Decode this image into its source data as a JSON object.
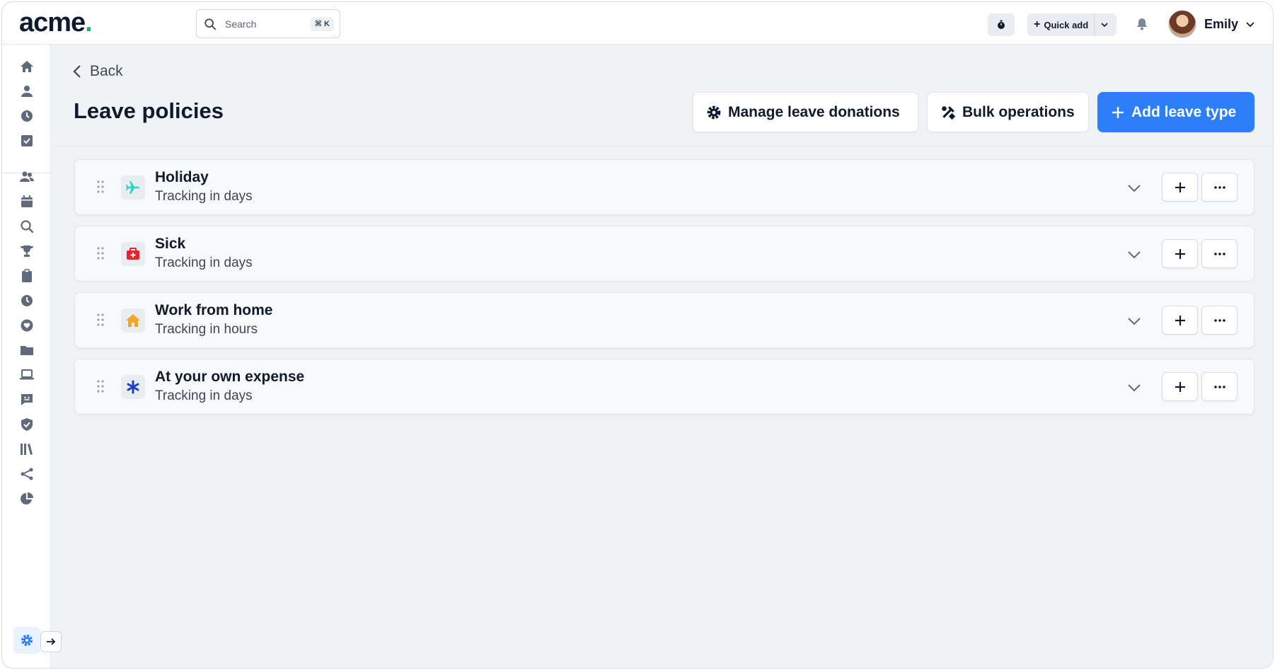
{
  "topbar": {
    "logo": "acme",
    "logo_dot": ".",
    "search_placeholder": "Search",
    "search_shortcut": "⌘ K",
    "quick_add_label": "Quick add",
    "user_name": "Emily"
  },
  "sidebar": {
    "items": [
      {
        "icon": "home-icon"
      },
      {
        "icon": "person-icon"
      },
      {
        "icon": "clock-icon"
      },
      {
        "icon": "checkbox-icon"
      },
      {
        "icon": "people-icon"
      },
      {
        "icon": "calendar-icon"
      },
      {
        "icon": "search-icon"
      },
      {
        "icon": "trophy-icon"
      },
      {
        "icon": "clipboard-icon"
      },
      {
        "icon": "time-icon"
      },
      {
        "icon": "heart-icon"
      },
      {
        "icon": "folder-icon"
      },
      {
        "icon": "laptop-icon"
      },
      {
        "icon": "feedback-icon"
      },
      {
        "icon": "shield-icon"
      },
      {
        "icon": "library-icon"
      },
      {
        "icon": "share-icon"
      },
      {
        "icon": "pie-chart-icon"
      }
    ]
  },
  "main": {
    "back_label": "Back",
    "title": "Leave policies",
    "actions": {
      "donations": "Manage leave donations",
      "bulk": "Bulk operations",
      "add": "Add leave type"
    },
    "policies": [
      {
        "name": "Holiday",
        "tracking": "Tracking in days",
        "icon": "airplane-icon",
        "color": "#2ed3c6"
      },
      {
        "name": "Sick",
        "tracking": "Tracking in days",
        "icon": "first-aid-icon",
        "color": "#e5252a"
      },
      {
        "name": "Work from home",
        "tracking": "Tracking in hours",
        "icon": "house-icon",
        "color": "#f5a524"
      },
      {
        "name": "At your own expense",
        "tracking": "Tracking in days",
        "icon": "asterisk-icon",
        "color": "#1d3fbf"
      }
    ]
  },
  "colors": {
    "accent": "#2d7ff9",
    "logo_dot": "#16b364",
    "background": "#f0f3f6"
  }
}
